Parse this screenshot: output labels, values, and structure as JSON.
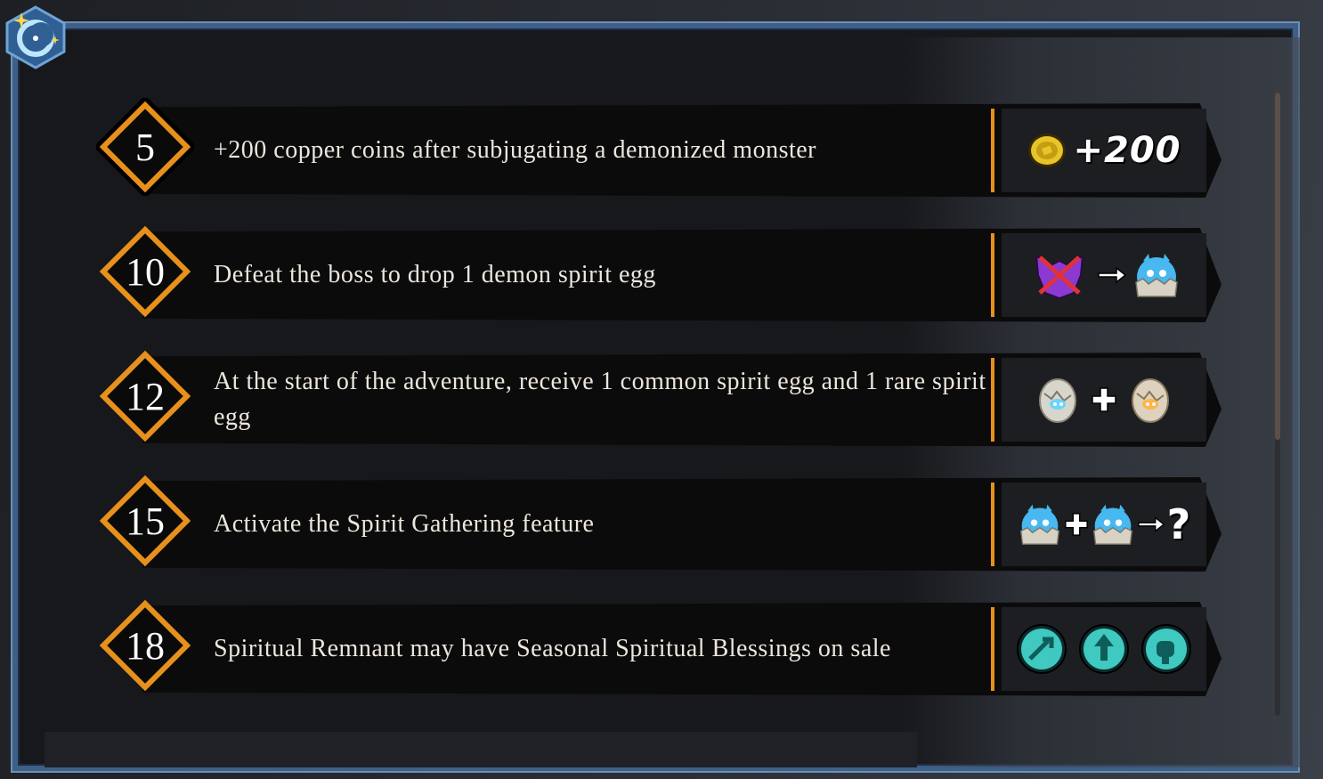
{
  "rows": [
    {
      "level": "5",
      "description": "+200 copper coins after subjugating a demonized monster",
      "reward": {
        "type": "coins",
        "text": "+200",
        "icons": [
          "copper-coin-icon"
        ]
      }
    },
    {
      "level": "10",
      "description": "Defeat the boss to drop 1 demon spirit egg",
      "reward": {
        "type": "boss-drop",
        "icons": [
          "boss-crossed-icon",
          "arrow-right-icon",
          "demon-spirit-egg-icon"
        ]
      }
    },
    {
      "level": "12",
      "description": "At the start of the adventure, receive 1 common spirit egg and 1 rare spirit egg",
      "reward": {
        "type": "eggs",
        "icons": [
          "common-spirit-egg-icon",
          "plus-icon",
          "rare-spirit-egg-icon"
        ]
      }
    },
    {
      "level": "15",
      "description": "Activate the Spirit Gathering feature",
      "reward": {
        "type": "gathering",
        "text": "?",
        "icons": [
          "demon-spirit-egg-icon",
          "plus-icon",
          "demon-spirit-egg-icon",
          "arrow-right-icon",
          "question-mark"
        ]
      }
    },
    {
      "level": "18",
      "description": "Spiritual Remnant may have Seasonal Spiritual Blessings on sale",
      "reward": {
        "type": "blessings",
        "icons": [
          "blessing-strike-icon",
          "blessing-up-icon",
          "blessing-fist-icon"
        ]
      }
    }
  ],
  "colors": {
    "accent": "#e8901c",
    "frame": "#3f5f87",
    "text": "#ece6dc"
  }
}
